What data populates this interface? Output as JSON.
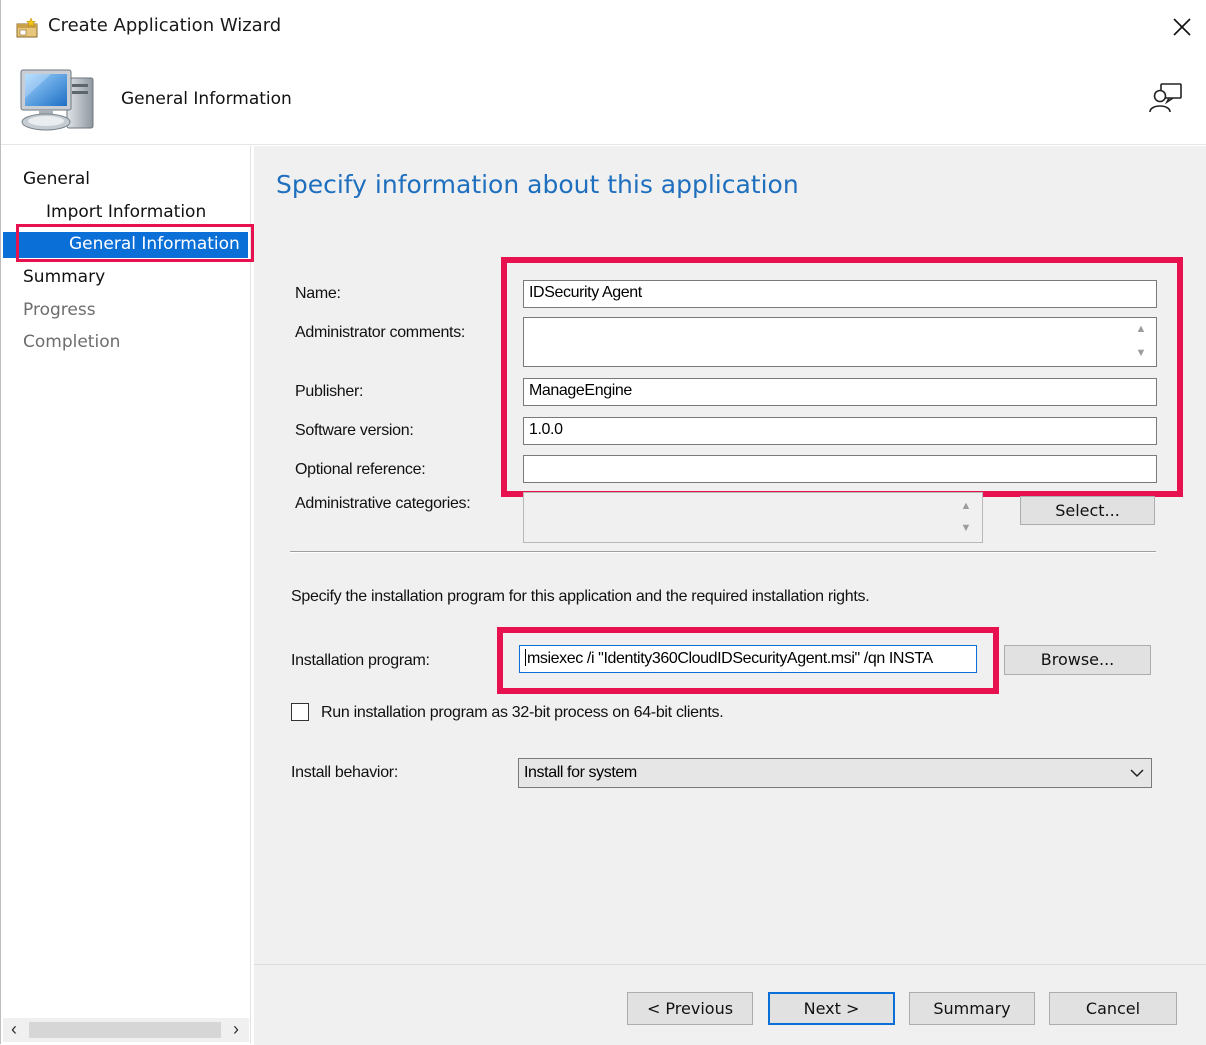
{
  "window": {
    "title": "Create Application Wizard",
    "header_title": "General Information",
    "page_heading": "Specify information about this application"
  },
  "nav": {
    "items": [
      {
        "label": "General",
        "state": "normal"
      },
      {
        "label": "Import Information",
        "state": "normal"
      },
      {
        "label": "General Information",
        "state": "selected"
      },
      {
        "label": "Summary",
        "state": "normal"
      },
      {
        "label": "Progress",
        "state": "disabled"
      },
      {
        "label": "Completion",
        "state": "disabled"
      }
    ]
  },
  "form": {
    "name_label": "Name:",
    "name_value": "IDSecurity Agent",
    "admin_comments_label": "Administrator comments:",
    "admin_comments_value": "",
    "publisher_label": "Publisher:",
    "publisher_value": "ManageEngine",
    "version_label": "Software version:",
    "version_value": "1.0.0",
    "optional_ref_label": "Optional reference:",
    "optional_ref_value": "",
    "admin_categories_label": "Administrative categories:",
    "select_button": "Select...",
    "install_instructions": "Specify the installation program for this application and the required installation rights.",
    "install_program_label": "Installation program:",
    "install_program_value": "msiexec /i \"Identity360CloudIDSecurityAgent.msi\" /qn INSTA",
    "browse_button": "Browse...",
    "run32_label": "Run installation program as 32-bit process on 64-bit clients.",
    "run32_checked": false,
    "install_behavior_label": "Install behavior:",
    "install_behavior_value": "Install for system"
  },
  "footer": {
    "previous": "< Previous",
    "next": "Next >",
    "summary": "Summary",
    "cancel": "Cancel"
  },
  "colors": {
    "accent": "#0a6fd7",
    "highlight": "#e8114f",
    "heading": "#1f6fbf",
    "disabled_text": "#6d6d6d"
  }
}
